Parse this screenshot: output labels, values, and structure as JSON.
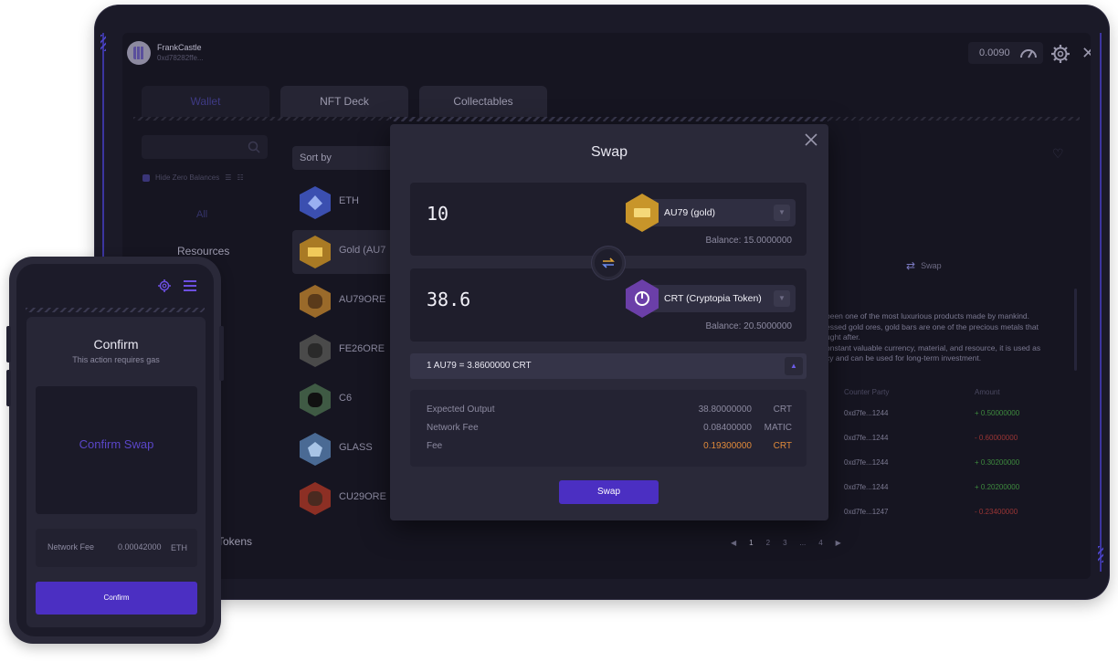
{
  "header": {
    "user_name": "FrankCastle",
    "user_address": "0xd78282ffe...",
    "gas_value": "0.0090"
  },
  "tabs": [
    {
      "label": "Wallet"
    },
    {
      "label": "NFT Deck"
    },
    {
      "label": "Collectables"
    }
  ],
  "sidebar": {
    "hide_zero_label": "Hide Zero Balances",
    "filter_all": "All",
    "filter_resources": "Resources",
    "filter_tokens": "Tokens"
  },
  "resources": {
    "sort_label": "Sort by",
    "items": [
      {
        "name": "ETH",
        "color": "#3b4fb0"
      },
      {
        "name": "Gold (AU7",
        "color": "#a97a24"
      },
      {
        "name": "AU79ORE",
        "color": "#9a6a2a"
      },
      {
        "name": "FE26ORE",
        "color": "#4a4a4a"
      },
      {
        "name": "C6",
        "color": "#3f5a44"
      },
      {
        "name": "GLASS",
        "color": "#4a6a94"
      },
      {
        "name": "CU29ORE",
        "color": "#8c2f24"
      }
    ]
  },
  "detail": {
    "paren": ")",
    "swap_tab_label": "Swap",
    "description": "been one of the most luxurious products made by mankind.\nessed gold ores, gold bars are one of the precious metals that\nught after.\nonstant valuable currency, material, and resource, it is used as\ncy and can be used for long-term investment.",
    "tx_header_party": "Counter Party",
    "tx_header_amount": "Amount",
    "transactions": [
      {
        "party": "0xd7fe...1244",
        "amount": "+ 0.50000000",
        "color": "#3e8a3e"
      },
      {
        "party": "0xd7fe...1244",
        "amount": "- 0.60000000",
        "color": "#9a3535"
      },
      {
        "party": "0xd7fe...1244",
        "amount": "+ 0.30200000",
        "color": "#3e8a3e"
      },
      {
        "party": "0xd7fe...1244",
        "amount": "+ 0.20200000",
        "color": "#3e8a3e"
      },
      {
        "party": "0xd7fe...1247",
        "amount": "- 0.23400000",
        "color": "#9a3535"
      }
    ],
    "pager": [
      "◀",
      "1",
      "2",
      "3",
      "...",
      "4",
      "▶"
    ]
  },
  "swap_modal": {
    "title": "Swap",
    "from": {
      "amount": "10",
      "token": "AU79 (gold)",
      "balance": "Balance: 15.0000000",
      "color": "#c8952a"
    },
    "to": {
      "amount": "38.6",
      "token": "CRT (Cryptopia Token)",
      "balance": "Balance: 20.5000000",
      "color": "#6b3fa8"
    },
    "rate": "1 AU79 = 3.8600000 CRT",
    "summary": [
      {
        "label": "Expected Output",
        "value": "38.80000000",
        "unit": "CRT",
        "color": "#8c8aa0"
      },
      {
        "label": "Network Fee",
        "value": "0.08400000",
        "unit": "MATIC",
        "color": "#8c8aa0"
      },
      {
        "label": "Fee",
        "value": "0.19300000",
        "unit": "CRT",
        "color": "#e08a3a"
      }
    ],
    "button_label": "Swap"
  },
  "phone": {
    "title": "Confirm",
    "subtitle": "This action requires gas",
    "confirm_area_label": "Confirm Swap",
    "fee_label": "Network Fee",
    "fee_value": "0.00042000",
    "fee_unit": "ETH",
    "button_label": "Confirm"
  },
  "colors": {
    "accent": "#4b2fc2",
    "background": "#161521",
    "panel": "#1f1e2c"
  }
}
